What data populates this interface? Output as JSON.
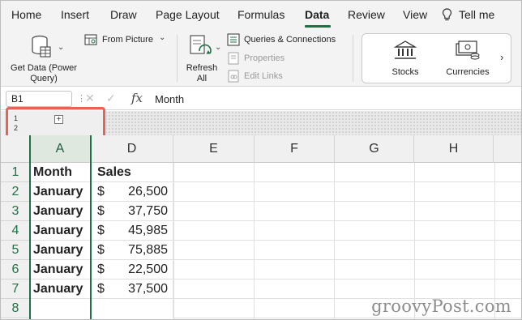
{
  "tabs": [
    "Home",
    "Insert",
    "Draw",
    "Page Layout",
    "Formulas",
    "Data",
    "Review",
    "View",
    "Tell me"
  ],
  "active_tab": "Data",
  "ribbon": {
    "get_data": "Get Data (Power Query)",
    "from_picture": "From Picture",
    "refresh_all": "Refresh All",
    "queries_connections": "Queries & Connections",
    "properties": "Properties",
    "edit_links": "Edit Links",
    "stocks": "Stocks",
    "currencies": "Currencies"
  },
  "formula_bar": {
    "name_box": "B1",
    "fx": "fx",
    "content": "Month"
  },
  "outline": {
    "level1": "1",
    "level2": "2",
    "expand": "+"
  },
  "columns": [
    "A",
    "D",
    "E",
    "F",
    "G",
    "H"
  ],
  "rows": [
    "1",
    "2",
    "3",
    "4",
    "5",
    "6",
    "7",
    "8"
  ],
  "header_row": {
    "month": "Month",
    "sales": "Sales"
  },
  "data_rows": [
    {
      "month": "January",
      "currency": "$",
      "amount": "26,500"
    },
    {
      "month": "January",
      "currency": "$",
      "amount": "37,750"
    },
    {
      "month": "January",
      "currency": "$",
      "amount": "45,985"
    },
    {
      "month": "January",
      "currency": "$",
      "amount": "75,885"
    },
    {
      "month": "January",
      "currency": "$",
      "amount": "22,500"
    },
    {
      "month": "January",
      "currency": "$",
      "amount": "37,500"
    }
  ],
  "watermark": "groovyPost.com",
  "colors": {
    "accent": "#1e7145",
    "highlight": "#e8625a"
  }
}
